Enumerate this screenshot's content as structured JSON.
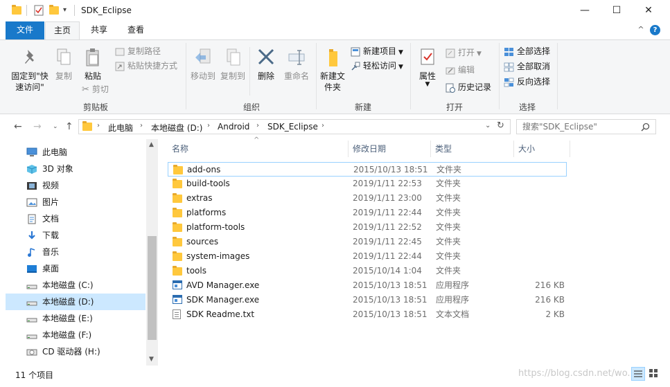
{
  "window": {
    "title": "SDK_Eclipse",
    "quick_access_more": "▾",
    "minimize": "—",
    "maximize": "☐",
    "close": "✕"
  },
  "ribbon_tabs": [
    "文件",
    "主页",
    "共享",
    "查看"
  ],
  "ribbon_right": {
    "collapse": "^",
    "help": "?"
  },
  "ribbon": {
    "clipboard": {
      "label": "剪贴板",
      "pin_quick_access": "固定到\"快速访问\"",
      "copy": "复制",
      "paste": "粘贴",
      "copy_path": "复制路径",
      "paste_shortcut": "粘贴快捷方式",
      "cut": "剪切"
    },
    "organize": {
      "label": "组织",
      "move_to": "移动到",
      "copy_to": "复制到",
      "delete": "删除",
      "rename": "重命名"
    },
    "new": {
      "label": "新建",
      "new_folder": "新建文件夹",
      "new_item": "新建项目",
      "easy_access": "轻松访问"
    },
    "open": {
      "label": "打开",
      "properties": "属性",
      "open": "打开",
      "edit": "编辑",
      "history": "历史记录"
    },
    "select": {
      "label": "选择",
      "select_all": "全部选择",
      "select_none": "全部取消",
      "invert": "反向选择"
    }
  },
  "address": {
    "crumbs": [
      "此电脑",
      "本地磁盘 (D:)",
      "Android",
      "SDK_Eclipse"
    ],
    "search_placeholder": "搜索\"SDK_Eclipse\""
  },
  "nav_pane": [
    {
      "label": "此电脑",
      "icon": "pc-icon",
      "selected": false
    },
    {
      "label": "3D 对象",
      "icon": "3d-objects-icon",
      "selected": false
    },
    {
      "label": "视频",
      "icon": "video-icon",
      "selected": false
    },
    {
      "label": "图片",
      "icon": "pictures-icon",
      "selected": false
    },
    {
      "label": "文档",
      "icon": "documents-icon",
      "selected": false
    },
    {
      "label": "下载",
      "icon": "download-icon",
      "selected": false
    },
    {
      "label": "音乐",
      "icon": "music-icon",
      "selected": false
    },
    {
      "label": "桌面",
      "icon": "desktop-icon",
      "selected": false
    },
    {
      "label": "本地磁盘 (C:)",
      "icon": "drive-icon",
      "selected": false
    },
    {
      "label": "本地磁盘 (D:)",
      "icon": "drive-icon",
      "selected": true
    },
    {
      "label": "本地磁盘 (E:)",
      "icon": "drive-icon",
      "selected": false
    },
    {
      "label": "本地磁盘 (F:)",
      "icon": "drive-icon",
      "selected": false
    },
    {
      "label": "CD 驱动器 (H:)",
      "icon": "cd-drive-icon",
      "selected": false
    }
  ],
  "columns": {
    "name": "名称",
    "date": "修改日期",
    "type": "类型",
    "size": "大小"
  },
  "files": [
    {
      "name": "add-ons",
      "date": "2015/10/13 18:51",
      "type": "文件夹",
      "size": "",
      "icon": "folder-icon"
    },
    {
      "name": "build-tools",
      "date": "2019/1/11 22:53",
      "type": "文件夹",
      "size": "",
      "icon": "folder-icon"
    },
    {
      "name": "extras",
      "date": "2019/1/11 23:00",
      "type": "文件夹",
      "size": "",
      "icon": "folder-icon"
    },
    {
      "name": "platforms",
      "date": "2019/1/11 22:44",
      "type": "文件夹",
      "size": "",
      "icon": "folder-icon"
    },
    {
      "name": "platform-tools",
      "date": "2019/1/11 22:52",
      "type": "文件夹",
      "size": "",
      "icon": "folder-icon"
    },
    {
      "name": "sources",
      "date": "2019/1/11 22:45",
      "type": "文件夹",
      "size": "",
      "icon": "folder-icon"
    },
    {
      "name": "system-images",
      "date": "2019/1/11 22:44",
      "type": "文件夹",
      "size": "",
      "icon": "folder-icon"
    },
    {
      "name": "tools",
      "date": "2015/10/14 1:04",
      "type": "文件夹",
      "size": "",
      "icon": "folder-icon"
    },
    {
      "name": "AVD Manager.exe",
      "date": "2015/10/13 18:51",
      "type": "应用程序",
      "size": "216 KB",
      "icon": "exe-icon"
    },
    {
      "name": "SDK Manager.exe",
      "date": "2015/10/13 18:51",
      "type": "应用程序",
      "size": "216 KB",
      "icon": "exe-icon"
    },
    {
      "name": "SDK Readme.txt",
      "date": "2015/10/13 18:51",
      "type": "文本文档",
      "size": "2 KB",
      "icon": "text-file-icon"
    }
  ],
  "status": {
    "count": "11 个项目",
    "watermark": "https://blog.csdn.net/wo..."
  },
  "colors": {
    "accent": "#1979ca",
    "selection": "#cce8ff",
    "folder": "#ffc83d"
  }
}
